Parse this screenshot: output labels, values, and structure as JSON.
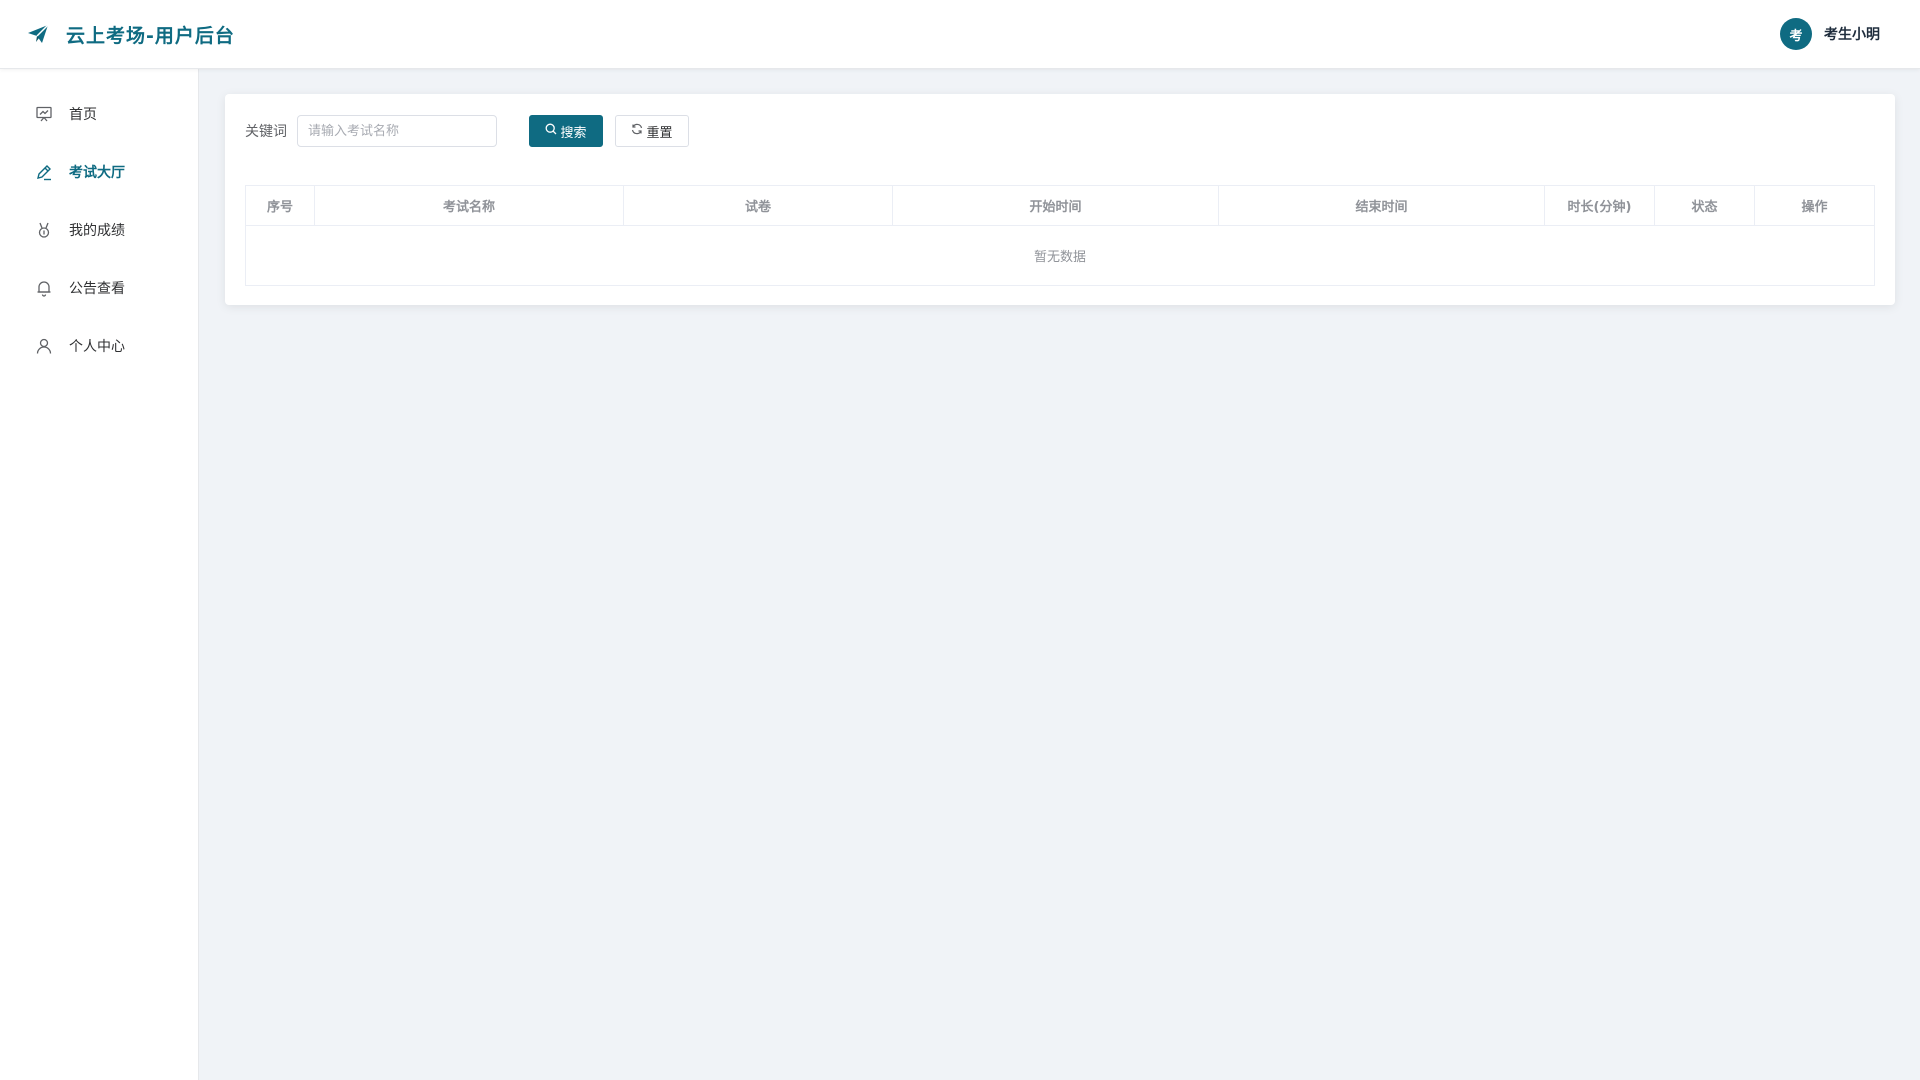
{
  "header": {
    "app_title": "云上考场-用户后台",
    "brand_icon": "paper-plane-icon",
    "user": {
      "avatar_text": "考",
      "name": "考生小明"
    }
  },
  "sidebar": {
    "items": [
      {
        "label": "首页",
        "icon": "presentation-board-icon",
        "active": false
      },
      {
        "label": "考试大厅",
        "icon": "edit-pen-icon",
        "active": true
      },
      {
        "label": "我的成绩",
        "icon": "medal-icon",
        "active": false
      },
      {
        "label": "公告查看",
        "icon": "bell-icon",
        "active": false
      },
      {
        "label": "个人中心",
        "icon": "user-icon",
        "active": false
      }
    ]
  },
  "filter": {
    "keyword_label": "关键词",
    "keyword_placeholder": "请输入考试名称",
    "keyword_value": "",
    "search_label": "搜索",
    "reset_label": "重置"
  },
  "table": {
    "columns": [
      "序号",
      "考试名称",
      "试卷",
      "开始时间",
      "结束时间",
      "时长(分钟)",
      "状态",
      "操作"
    ],
    "rows": [],
    "empty_text": "暂无数据"
  },
  "colors": {
    "primary": "#0f6b82",
    "page_background": "#f0f3f7",
    "muted_text": "#909399"
  }
}
